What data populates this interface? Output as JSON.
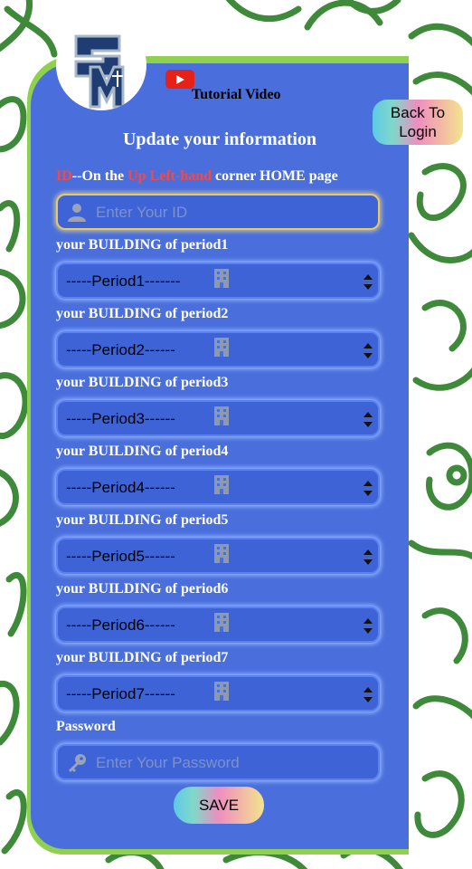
{
  "header": {
    "tutorial_label": "Tutorial Video",
    "back_label_line1": "Back To",
    "back_label_line2": "Login"
  },
  "form": {
    "title": "Update your information",
    "id_note": {
      "part1": "ID",
      "part2": "--On the ",
      "part3": "Up Left-hand",
      "part4": " corner HOME page"
    },
    "id_placeholder": "Enter Your ID",
    "periods": [
      {
        "label": "your BUILDING of period1",
        "selected": "-----Period1-------"
      },
      {
        "label": "your BUILDING of period2",
        "selected": "-----Period2------"
      },
      {
        "label": "your BUILDING of period3",
        "selected": "-----Period3------"
      },
      {
        "label": "your BUILDING of period4",
        "selected": "-----Period4------"
      },
      {
        "label": "your BUILDING of period5",
        "selected": "-----Period5------"
      },
      {
        "label": "your BUILDING of period6",
        "selected": "-----Period6------"
      },
      {
        "label": "your BUILDING of period7",
        "selected": "-----Period7------"
      }
    ],
    "password_label": "Password",
    "password_placeholder": "Enter Your Password",
    "save_label": "SAVE"
  },
  "colors": {
    "card": "#4a6fdc",
    "card_border": "#8fd14f",
    "accent_red": "#f04a4a",
    "doodle": "#3f8a3a"
  }
}
